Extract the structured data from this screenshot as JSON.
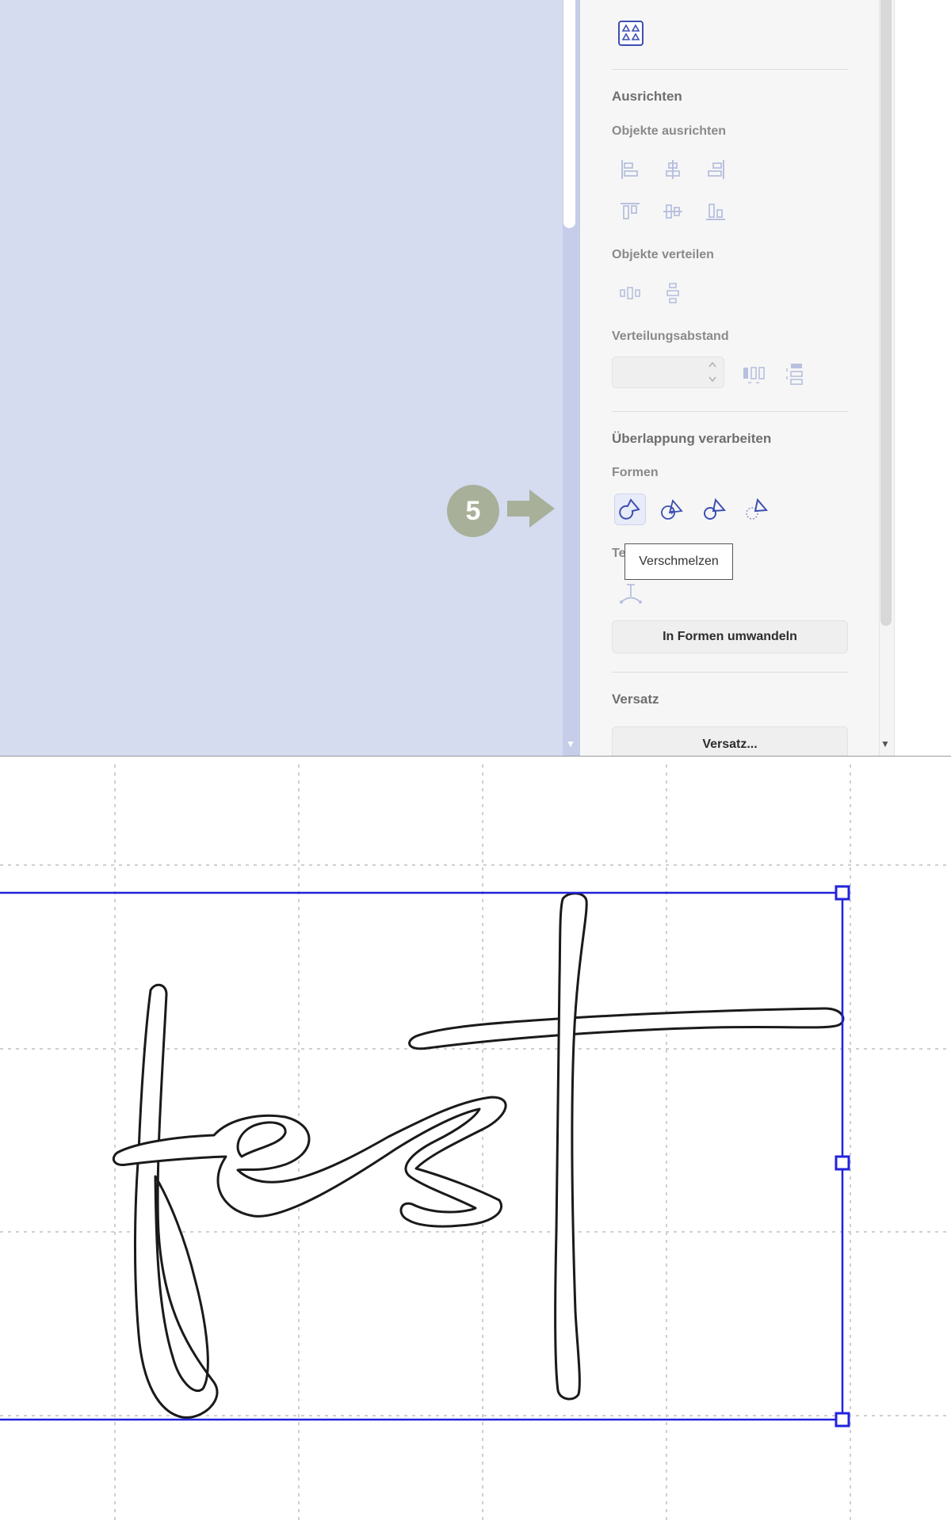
{
  "panel": {
    "group_icon": "group-icon",
    "align": {
      "title": "Ausrichten",
      "objects_align_label": "Objekte ausrichten",
      "icons": [
        "align-left-icon",
        "align-center-horizontal-icon",
        "align-right-icon",
        "align-top-icon",
        "align-center-vertical-icon",
        "align-bottom-icon"
      ]
    },
    "distribute": {
      "label": "Objekte verteilen",
      "icons": [
        "distribute-horizontal-icon",
        "distribute-vertical-icon"
      ]
    },
    "spacing": {
      "label": "Verteilungsabstand",
      "value": "",
      "icons": [
        "spacing-horizontal-icon",
        "spacing-vertical-icon"
      ]
    },
    "overlap": {
      "title": "Überlappung verarbeiten",
      "shapes_label": "Formen",
      "shape_icons": [
        "weld-icon",
        "intersect-icon",
        "subtract-icon",
        "exclude-icon"
      ],
      "text_label": "Text",
      "text_icon": "text-path-icon",
      "convert_button": "In Formen umwandeln"
    },
    "offset": {
      "title": "Versatz",
      "button": "Versatz..."
    }
  },
  "tooltip": {
    "text": "Verschmelzen"
  },
  "step_badge": {
    "number": "5"
  },
  "colors": {
    "accent": "#3d4fb3",
    "canvas_bg": "#d5dcf0",
    "badge": "#a8b09a",
    "selection": "#2222dd"
  }
}
